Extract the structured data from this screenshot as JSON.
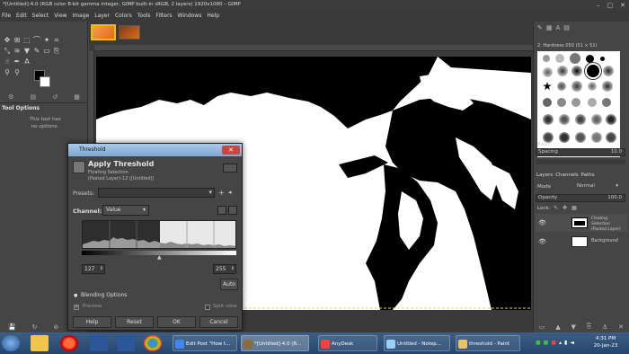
{
  "window": {
    "title": "*[Untitled]-4.0 (RGB color 8-bit gamma integer, GIMP built-in sRGB, 2 layers) 1920x1080 – GIMP",
    "controls": [
      "–",
      "□",
      "✕"
    ]
  },
  "menubar": [
    "File",
    "Edit",
    "Select",
    "View",
    "Image",
    "Layer",
    "Colors",
    "Tools",
    "Filters",
    "Windows",
    "Help"
  ],
  "tool_options": {
    "title": "Tool Options",
    "message": "This tool has\nno options."
  },
  "right_dock": {
    "brushes_header": "2. Hardness 050 (51 × 51)",
    "brush_category": "Basic,",
    "spacing_label": "Spacing",
    "spacing_value": "10.0",
    "layers_tabs": [
      "Layers",
      "Channels",
      "Paths"
    ],
    "mode_label": "Mode",
    "mode_value": "Normal",
    "opacity_label": "Opacity",
    "opacity_value": "100.0",
    "lock_label": "Lock:",
    "layers": [
      {
        "name": "Floating Selection\n(Pasted Layer)"
      },
      {
        "name": "Background"
      }
    ]
  },
  "dialog": {
    "window_title": "Threshold",
    "heading": "Apply Threshold",
    "subheading": "Floating Selection",
    "subheading2": "(Pasted Layer)-12 ([Untitled])",
    "presets_label": "Presets:",
    "channel_label": "Channel:",
    "channel_value": "Value",
    "low_value": "127",
    "high_value": "255",
    "auto_label": "Auto",
    "blending_label": "Blending Options",
    "preview_label": "Preview",
    "split_label": "Split view",
    "buttons": [
      "Help",
      "Reset",
      "OK",
      "Cancel"
    ]
  },
  "taskbar": {
    "items": [
      "Edit Post \"How t...",
      "*[Untitled]-4.0 (R...",
      "AnyDesk",
      "Untitled - Notep...",
      "threshold - Paint"
    ],
    "time": "4:31 PM",
    "date": "20-Jan-23",
    "colors": {
      "accent": "#24466e"
    }
  }
}
